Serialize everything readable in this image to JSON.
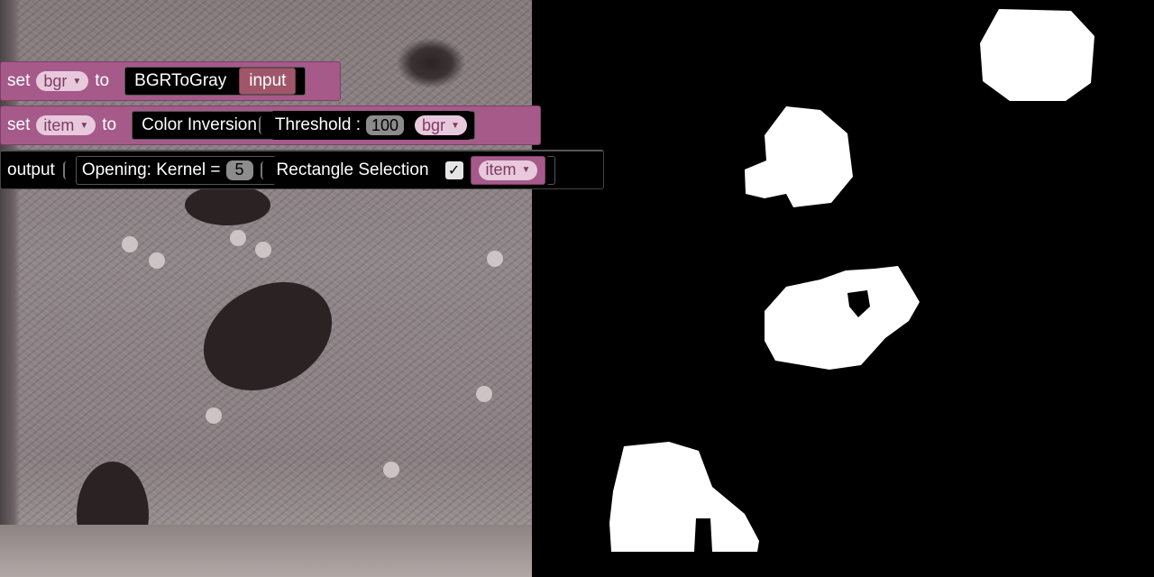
{
  "blocks": {
    "row1": {
      "set": "set",
      "var": "bgr",
      "to": "to",
      "func": "BGRToGray",
      "arg": "input"
    },
    "row2": {
      "set": "set",
      "var": "item",
      "to": "to",
      "func1": "Color Inversion",
      "func2": "Threshold :",
      "threshold": "100",
      "arg": "bgr"
    },
    "row3": {
      "label": "output",
      "func1": "Opening: Kernel =",
      "kernel": "5",
      "func2": "Rectangle Selection",
      "checked": "✓",
      "arg": "item"
    }
  },
  "icons": {
    "dropdown": "caret-down-icon",
    "checkbox": "checkmark-icon"
  },
  "colors": {
    "block_purple": "#a55a8a",
    "dropdown_bg": "#e8c9dc",
    "input_block": "#a0566a",
    "mask_white": "#ffffff",
    "mask_black": "#000000"
  }
}
